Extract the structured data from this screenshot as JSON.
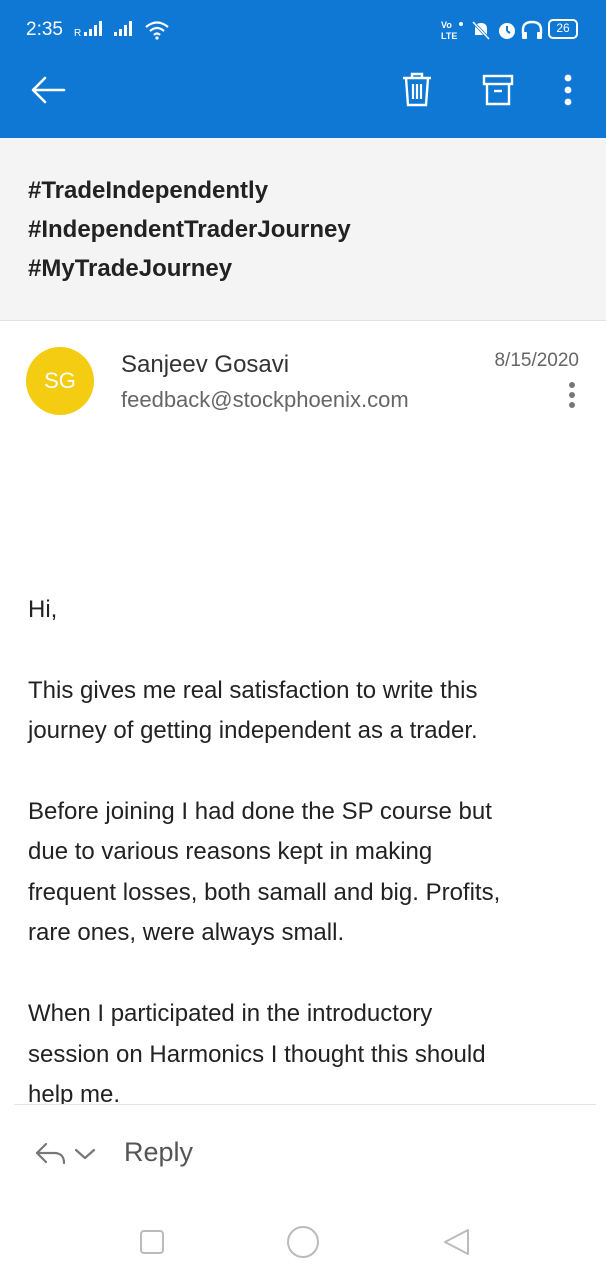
{
  "status_bar": {
    "time": "2:35",
    "battery": "26",
    "network_label": "Vo LTE"
  },
  "toolbar": {
    "back_icon": "arrow-left-icon",
    "delete_icon": "trash-icon",
    "archive_icon": "archive-icon",
    "more_icon": "more-vertical-icon"
  },
  "subject": {
    "lines": [
      "#TradeIndependently",
      "#IndependentTraderJourney",
      "#MyTradeJourney"
    ]
  },
  "message": {
    "avatar_initials": "SG",
    "avatar_color": "#f4cc12",
    "sender_name": "Sanjeev Gosavi",
    "sender_email": "feedback@stockphoenix.com",
    "date": "8/15/2020",
    "greeting": "Hi,",
    "para1_lines": [
      "This gives me real satisfaction to write this",
      "journey of getting independent as a trader."
    ],
    "para2_lines": [
      "Before joining I had done the SP course but",
      "due to various reasons kept in making",
      "frequent losses, both samall and big. Profits,",
      "rare ones, were always small."
    ],
    "para3_lines": [
      "When I participated in the introductory",
      "session on Harmonics I thought this should",
      "help me."
    ]
  },
  "reply_bar": {
    "reply_label": "Reply"
  },
  "colors": {
    "accent": "#0f78d4",
    "subject_bg": "#f4f4f4"
  }
}
